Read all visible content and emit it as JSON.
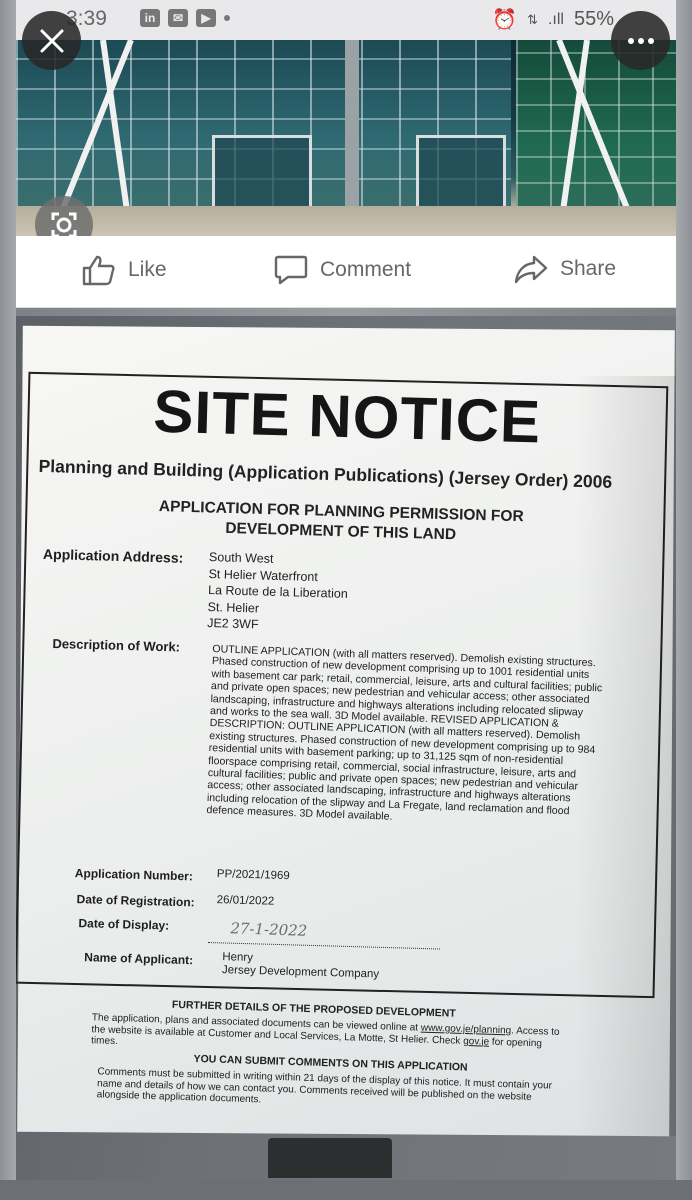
{
  "status_bar": {
    "time": "3:39",
    "battery": "55%"
  },
  "photo_viewer": {
    "close_label": "×",
    "more_label": "•••"
  },
  "actions": {
    "like": "Like",
    "comment": "Comment",
    "share": "Share"
  },
  "notice": {
    "title": "SITE NOTICE",
    "order": "Planning and Building (Application Publications) (Jersey Order) 2006",
    "application_heading_line1": "APPLICATION FOR PLANNING PERMISSION FOR",
    "application_heading_line2": "DEVELOPMENT OF THIS LAND",
    "address_label": "Application Address:",
    "address_lines": [
      "South West",
      "St Helier Waterfront",
      "La Route de la Liberation",
      "St. Helier",
      "JE2 3WF"
    ],
    "description_label": "Description of Work:",
    "description": "OUTLINE APPLICATION (with all matters reserved). Demolish existing structures. Phased construction of new development comprising up to 1001 residential units with basement car park; retail, commercial, leisure, arts and cultural facilities; public and private open spaces; new pedestrian and vehicular access; other associated landscaping, infrastructure and highways alterations including relocated slipway and works to the sea wall. 3D Model available. REVISED APPLICATION & DESCRIPTION: OUTLINE APPLICATION (with all matters reserved). Demolish existing structures. Phased construction of new development comprising up to 984 residential units with basement parking; up to 31,125 sqm of non-residential floorspace comprising retail, commercial, social infrastructure, leisure, arts and cultural facilities; public and private open spaces; new pedestrian and vehicular access; other associated landscaping, infrastructure and highways alterations including relocation of the slipway and La Fregate, land reclamation and flood defence measures. 3D Model available.",
    "app_number_label": "Application Number:",
    "app_number": "PP/2021/1969",
    "registration_label": "Date of Registration:",
    "registration_date": "26/01/2022",
    "display_label": "Date of Display:",
    "display_date_handwritten": "27-1-2022",
    "applicant_label": "Name of Applicant:",
    "applicant_line1": "Henry",
    "applicant_line2": "Jersey Development Company",
    "further_heading": "FURTHER DETAILS OF THE PROPOSED DEVELOPMENT",
    "further_text_1": "The application, plans and associated documents can be viewed online at",
    "further_link_1": "www.gov.je/planning",
    "further_text_2": ". Access to the website is available at Customer and Local Services, La Motte, St Helier. Check ",
    "further_link_2": "gov.je",
    "further_text_3": " for opening times.",
    "comments_heading": "YOU CAN SUBMIT COMMENTS ON THIS APPLICATION",
    "comments_text": "Comments must be submitted in writing within 21 days of the display of this notice. It must contain your name and details of how we can contact you. Comments received will be published on the website alongside the application documents."
  }
}
